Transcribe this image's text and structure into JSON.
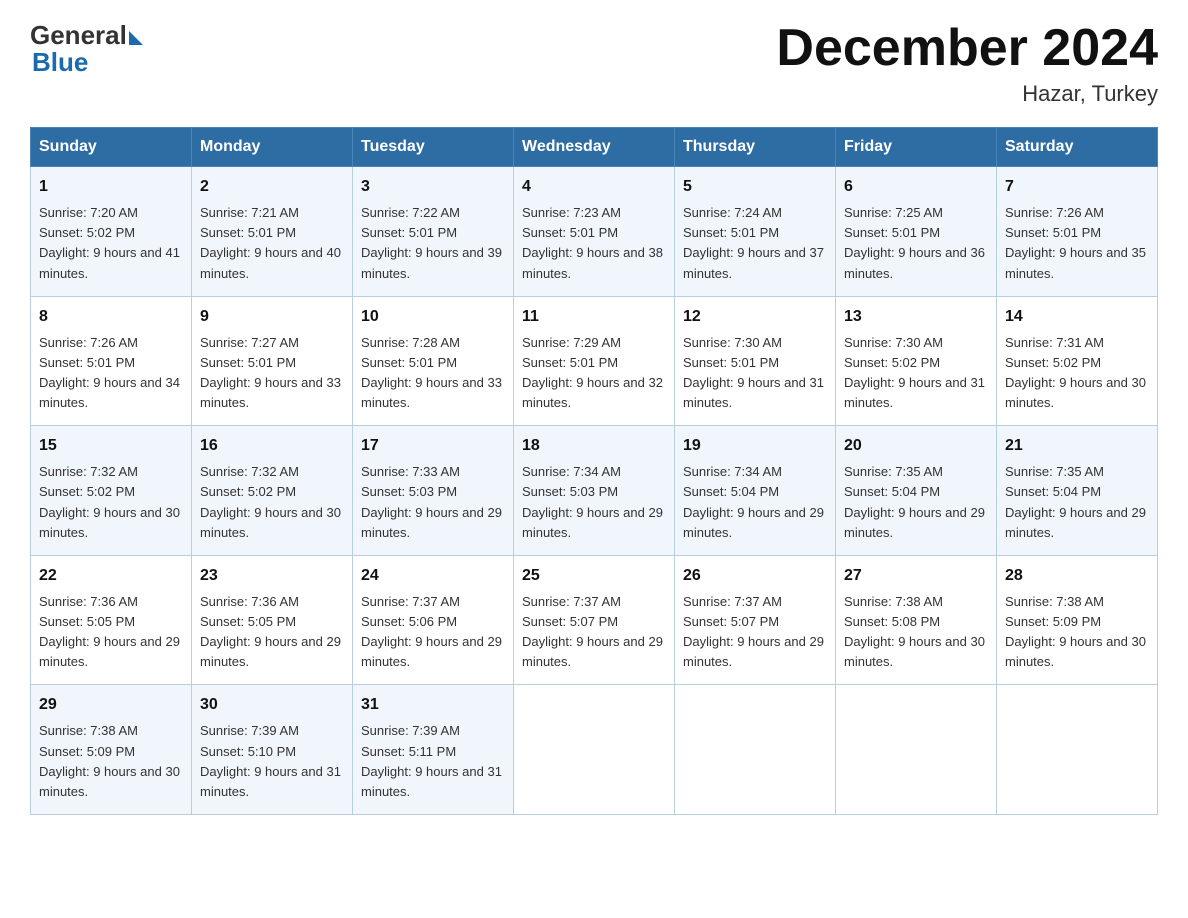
{
  "logo": {
    "general": "General",
    "blue": "Blue"
  },
  "header": {
    "title": "December 2024",
    "location": "Hazar, Turkey"
  },
  "weekdays": [
    "Sunday",
    "Monday",
    "Tuesday",
    "Wednesday",
    "Thursday",
    "Friday",
    "Saturday"
  ],
  "weeks": [
    [
      {
        "day": "1",
        "sunrise": "7:20 AM",
        "sunset": "5:02 PM",
        "daylight": "9 hours and 41 minutes."
      },
      {
        "day": "2",
        "sunrise": "7:21 AM",
        "sunset": "5:01 PM",
        "daylight": "9 hours and 40 minutes."
      },
      {
        "day": "3",
        "sunrise": "7:22 AM",
        "sunset": "5:01 PM",
        "daylight": "9 hours and 39 minutes."
      },
      {
        "day": "4",
        "sunrise": "7:23 AM",
        "sunset": "5:01 PM",
        "daylight": "9 hours and 38 minutes."
      },
      {
        "day": "5",
        "sunrise": "7:24 AM",
        "sunset": "5:01 PM",
        "daylight": "9 hours and 37 minutes."
      },
      {
        "day": "6",
        "sunrise": "7:25 AM",
        "sunset": "5:01 PM",
        "daylight": "9 hours and 36 minutes."
      },
      {
        "day": "7",
        "sunrise": "7:26 AM",
        "sunset": "5:01 PM",
        "daylight": "9 hours and 35 minutes."
      }
    ],
    [
      {
        "day": "8",
        "sunrise": "7:26 AM",
        "sunset": "5:01 PM",
        "daylight": "9 hours and 34 minutes."
      },
      {
        "day": "9",
        "sunrise": "7:27 AM",
        "sunset": "5:01 PM",
        "daylight": "9 hours and 33 minutes."
      },
      {
        "day": "10",
        "sunrise": "7:28 AM",
        "sunset": "5:01 PM",
        "daylight": "9 hours and 33 minutes."
      },
      {
        "day": "11",
        "sunrise": "7:29 AM",
        "sunset": "5:01 PM",
        "daylight": "9 hours and 32 minutes."
      },
      {
        "day": "12",
        "sunrise": "7:30 AM",
        "sunset": "5:01 PM",
        "daylight": "9 hours and 31 minutes."
      },
      {
        "day": "13",
        "sunrise": "7:30 AM",
        "sunset": "5:02 PM",
        "daylight": "9 hours and 31 minutes."
      },
      {
        "day": "14",
        "sunrise": "7:31 AM",
        "sunset": "5:02 PM",
        "daylight": "9 hours and 30 minutes."
      }
    ],
    [
      {
        "day": "15",
        "sunrise": "7:32 AM",
        "sunset": "5:02 PM",
        "daylight": "9 hours and 30 minutes."
      },
      {
        "day": "16",
        "sunrise": "7:32 AM",
        "sunset": "5:02 PM",
        "daylight": "9 hours and 30 minutes."
      },
      {
        "day": "17",
        "sunrise": "7:33 AM",
        "sunset": "5:03 PM",
        "daylight": "9 hours and 29 minutes."
      },
      {
        "day": "18",
        "sunrise": "7:34 AM",
        "sunset": "5:03 PM",
        "daylight": "9 hours and 29 minutes."
      },
      {
        "day": "19",
        "sunrise": "7:34 AM",
        "sunset": "5:04 PM",
        "daylight": "9 hours and 29 minutes."
      },
      {
        "day": "20",
        "sunrise": "7:35 AM",
        "sunset": "5:04 PM",
        "daylight": "9 hours and 29 minutes."
      },
      {
        "day": "21",
        "sunrise": "7:35 AM",
        "sunset": "5:04 PM",
        "daylight": "9 hours and 29 minutes."
      }
    ],
    [
      {
        "day": "22",
        "sunrise": "7:36 AM",
        "sunset": "5:05 PM",
        "daylight": "9 hours and 29 minutes."
      },
      {
        "day": "23",
        "sunrise": "7:36 AM",
        "sunset": "5:05 PM",
        "daylight": "9 hours and 29 minutes."
      },
      {
        "day": "24",
        "sunrise": "7:37 AM",
        "sunset": "5:06 PM",
        "daylight": "9 hours and 29 minutes."
      },
      {
        "day": "25",
        "sunrise": "7:37 AM",
        "sunset": "5:07 PM",
        "daylight": "9 hours and 29 minutes."
      },
      {
        "day": "26",
        "sunrise": "7:37 AM",
        "sunset": "5:07 PM",
        "daylight": "9 hours and 29 minutes."
      },
      {
        "day": "27",
        "sunrise": "7:38 AM",
        "sunset": "5:08 PM",
        "daylight": "9 hours and 30 minutes."
      },
      {
        "day": "28",
        "sunrise": "7:38 AM",
        "sunset": "5:09 PM",
        "daylight": "9 hours and 30 minutes."
      }
    ],
    [
      {
        "day": "29",
        "sunrise": "7:38 AM",
        "sunset": "5:09 PM",
        "daylight": "9 hours and 30 minutes."
      },
      {
        "day": "30",
        "sunrise": "7:39 AM",
        "sunset": "5:10 PM",
        "daylight": "9 hours and 31 minutes."
      },
      {
        "day": "31",
        "sunrise": "7:39 AM",
        "sunset": "5:11 PM",
        "daylight": "9 hours and 31 minutes."
      },
      null,
      null,
      null,
      null
    ]
  ]
}
